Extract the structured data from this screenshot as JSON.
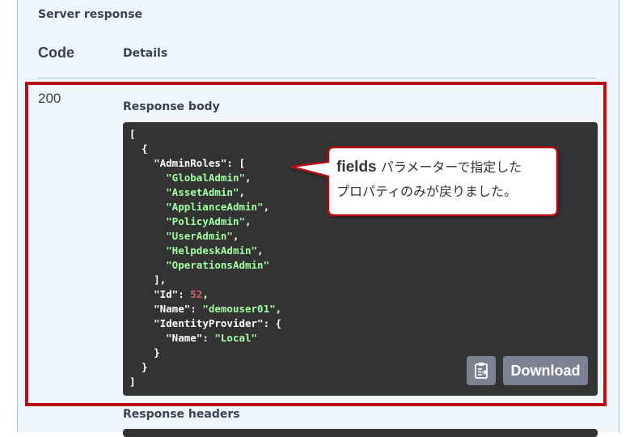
{
  "server_response": {
    "title": "Server response",
    "columns": {
      "code": "Code",
      "details": "Details"
    },
    "status_code": "200",
    "response_body_label": "Response body",
    "response_headers_label": "Response headers",
    "download_label": "Download",
    "json": {
      "admin_roles_key": "\"AdminRoles\"",
      "admin_roles": [
        "\"GlobalAdmin\"",
        "\"AssetAdmin\"",
        "\"ApplianceAdmin\"",
        "\"PolicyAdmin\"",
        "\"UserAdmin\"",
        "\"HelpdeskAdmin\"",
        "\"OperationsAdmin\""
      ],
      "id_key": "\"Id\"",
      "id_value": "52",
      "name_key": "\"Name\"",
      "name_value": "\"demouser01\"",
      "identity_provider_key": "\"IdentityProvider\"",
      "ip_name_key": "\"Name\"",
      "ip_name_value": "\"Local\""
    }
  },
  "callout": {
    "keyword": "fields",
    "line1": "パラメーターで指定した",
    "line2": "プロパティのみが戻りました。"
  },
  "colors": {
    "highlight_border": "#b80d12",
    "code_background": "#333333",
    "json_string": "#a2fca2",
    "json_number": "#d36363",
    "button": "#7d8293"
  },
  "icons": {
    "copy": "clipboard-copy-icon"
  }
}
